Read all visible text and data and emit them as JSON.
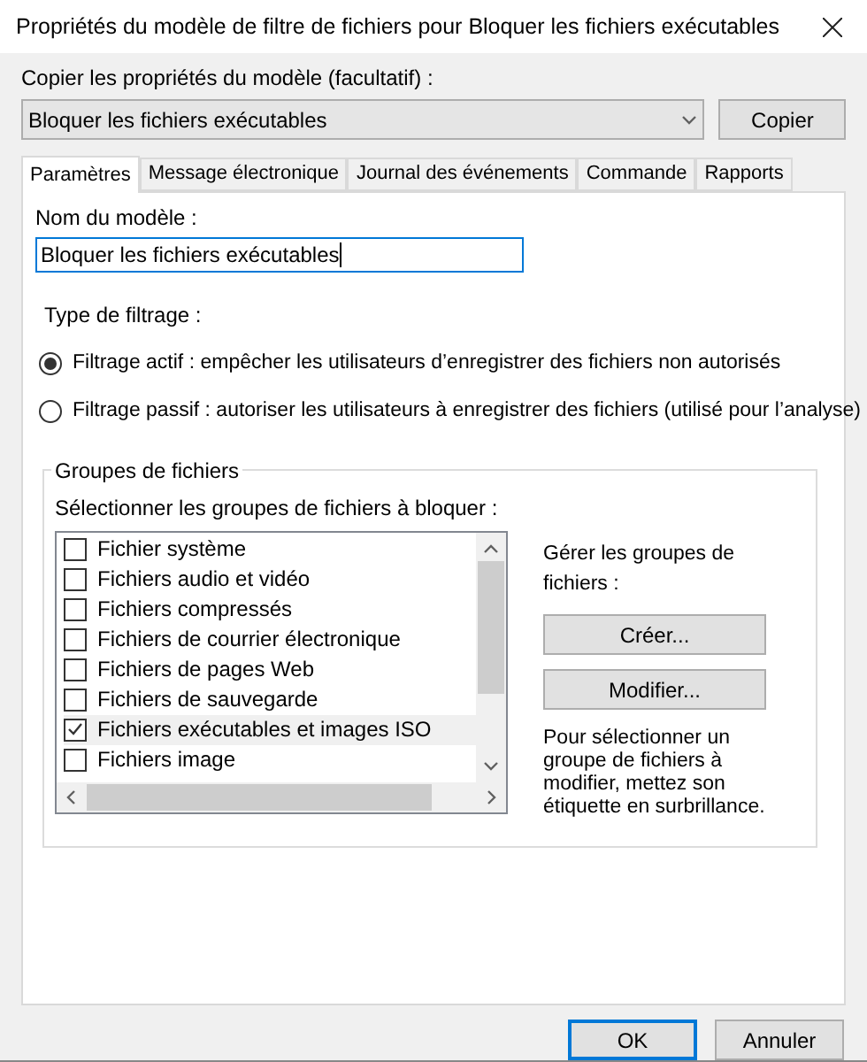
{
  "window": {
    "title": "Propriétés du modèle de filtre de fichiers pour Bloquer les fichiers exécutables"
  },
  "copy": {
    "label": "Copier les propriétés du modèle (facultatif) :",
    "value": "Bloquer les fichiers exécutables",
    "button": "Copier"
  },
  "tabs": [
    {
      "label": "Paramètres",
      "selected": true
    },
    {
      "label": "Message électronique",
      "selected": false
    },
    {
      "label": "Journal des événements",
      "selected": false
    },
    {
      "label": "Commande",
      "selected": false
    },
    {
      "label": "Rapports",
      "selected": false
    }
  ],
  "name_field": {
    "label": "Nom du modèle :",
    "value": "Bloquer les fichiers exécutables"
  },
  "filtering": {
    "label": "Type de filtrage :",
    "options": [
      {
        "label": "Filtrage actif : empêcher les utilisateurs d’enregistrer des fichiers non autorisés",
        "selected": true
      },
      {
        "label": "Filtrage passif : autoriser les utilisateurs à enregistrer des fichiers (utilisé pour l’analyse)",
        "selected": false
      }
    ]
  },
  "groups": {
    "title": "Groupes de fichiers",
    "list_label": "Sélectionner les groupes de fichiers à bloquer :",
    "items": [
      {
        "label": "Fichier système",
        "checked": false,
        "selected": false
      },
      {
        "label": "Fichiers audio et vidéo",
        "checked": false,
        "selected": false
      },
      {
        "label": "Fichiers compressés",
        "checked": false,
        "selected": false
      },
      {
        "label": "Fichiers de courrier électronique",
        "checked": false,
        "selected": false
      },
      {
        "label": "Fichiers de pages Web",
        "checked": false,
        "selected": false
      },
      {
        "label": "Fichiers de sauvegarde",
        "checked": false,
        "selected": false
      },
      {
        "label": "Fichiers exécutables et images ISO",
        "checked": true,
        "selected": true
      },
      {
        "label": "Fichiers image",
        "checked": false,
        "selected": false
      }
    ],
    "manage_label": "Gérer les groupes de fichiers :",
    "buttons": [
      "Créer...",
      "Modifier..."
    ],
    "hint": "Pour sélectionner un groupe de fichiers à modifier, mettez son étiquette en surbrillance."
  },
  "buttons": [
    {
      "label": "OK",
      "default": true
    },
    {
      "label": "Annuler",
      "default": false
    }
  ]
}
